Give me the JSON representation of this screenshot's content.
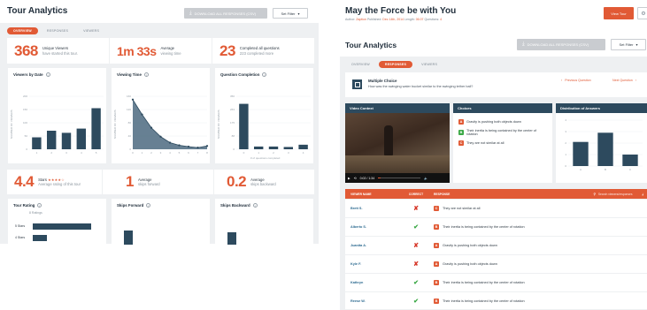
{
  "left": {
    "title": "Tour Analytics",
    "download_label": "DOWNLOAD ALL RESPONSES (CSV)",
    "filter_label": "Set Filter",
    "tabs": [
      {
        "label": "OVERVIEW",
        "active": true
      },
      {
        "label": "RESPONSES",
        "active": false
      },
      {
        "label": "VIEWERS",
        "active": false
      }
    ],
    "stats_top": [
      {
        "value": "368",
        "label": "Unique Viewers",
        "sub": "have started this tour."
      },
      {
        "value": "1m 33s",
        "label": "Average",
        "sub": "viewing time"
      },
      {
        "value": "23",
        "label": "Completed all questions",
        "sub": "223 completed more"
      }
    ],
    "charts": [
      {
        "title": "Viewers by Date",
        "ylabel": "NUMBER OF VIEWERS"
      },
      {
        "title": "Viewing Time",
        "ylabel": "NUMBER OF VIEWERS"
      },
      {
        "title": "Question Completion",
        "ylabel": "NUMBER OF VIEWERS",
        "note": "# of questions completed"
      }
    ],
    "stats_bottom": [
      {
        "value": "4.4",
        "label": "Stars",
        "stars": "★★★★☆",
        "sub": "Average rating of this tour"
      },
      {
        "value": "1",
        "label": "Average",
        "sub": "skips forward"
      },
      {
        "value": "0.2",
        "label": "Average",
        "sub": "skips backward"
      }
    ],
    "bottom_cards": [
      {
        "title": "Tour Rating",
        "sub": "8 Ratings",
        "rows": [
          "5 Stars",
          "4 Stars"
        ]
      },
      {
        "title": "Skips Forward"
      },
      {
        "title": "Skips Backward"
      }
    ]
  },
  "right": {
    "title": "May the Force be with You",
    "meta": {
      "author_label": "Author:",
      "author": "Zaption",
      "published_label": "Published:",
      "published": "Dec 14th, 2014",
      "length_label": "Length:",
      "length": "06:07",
      "questions_label": "Questions:",
      "questions": "4"
    },
    "view_tour_label": "View Tour",
    "subtitle": "Tour Analytics",
    "download_label": "DOWNLOAD ALL RESPONSES (CSV)",
    "filter_label": "Set Filter",
    "tabs": [
      {
        "label": "OVERVIEW",
        "active": false
      },
      {
        "label": "RESPONSES",
        "active": true
      },
      {
        "label": "VIEWERS",
        "active": false
      }
    ],
    "question": {
      "type": "Multiple Choice",
      "text": "How was the swinging water bucket similar to the swinging tether ball?"
    },
    "prev_label": "Previous Question",
    "next_label": "Next Question",
    "video_header": "Video Context",
    "video_time": "0:02 / 1:34",
    "choices_header": "Choices",
    "choices": [
      {
        "letter": "A",
        "text": "Gravity is pushing both objects down",
        "correct": false
      },
      {
        "letter": "B",
        "text": "Their inertia is being contained by the center of rotation",
        "correct": true
      },
      {
        "letter": "C",
        "text": "They are not similar at all",
        "correct": false
      }
    ],
    "dist_header": "Distribution of Answers",
    "table": {
      "headers": [
        "VIEWER NAME",
        "CORRECT",
        "RESPONSE"
      ],
      "search_placeholder": "Search viewers/responses",
      "rows": [
        {
          "name": "Brett S.",
          "correct": false,
          "letter": "C",
          "response": "They are not similar at all"
        },
        {
          "name": "Alberto S.",
          "correct": true,
          "letter": "B",
          "response": "Their inertia is being contained by the center of rotation"
        },
        {
          "name": "Juanita A.",
          "correct": false,
          "letter": "A",
          "response": "Gravity is pushing both objects down"
        },
        {
          "name": "Kyle F.",
          "correct": false,
          "letter": "A",
          "response": "Gravity is pushing both objects down"
        },
        {
          "name": "Kathryn",
          "correct": true,
          "letter": "B",
          "response": "Their inertia is being contained by the center of rotation"
        },
        {
          "name": "Reese W.",
          "correct": true,
          "letter": "B",
          "response": "Their inertia is being contained by the center of rotation"
        }
      ]
    }
  },
  "colors": {
    "accent": "#e15a35",
    "navy": "#2d4a5e",
    "correct": "#3aa845",
    "wrong": "#d7392b"
  },
  "chart_data": [
    {
      "type": "bar",
      "title": "Viewers by Date",
      "ylabel": "NUMBER OF VIEWERS",
      "categories": [
        "1",
        "2",
        "3",
        "4",
        "5"
      ],
      "values": [
        45,
        70,
        62,
        78,
        155
      ],
      "ylim": [
        0,
        200
      ]
    },
    {
      "type": "area",
      "title": "Viewing Time",
      "ylabel": "NUMBER OF VIEWERS",
      "x": [
        0,
        1,
        2,
        3,
        4,
        5,
        6,
        7,
        8
      ],
      "values": [
        150,
        105,
        65,
        38,
        20,
        12,
        8,
        5,
        10
      ],
      "ylim": [
        0,
        160
      ]
    },
    {
      "type": "bar",
      "title": "Question Completion",
      "ylabel": "NUMBER OF VIEWERS",
      "categories": [
        "0",
        "1",
        "2",
        "3",
        "4"
      ],
      "values": [
        300,
        18,
        18,
        15,
        30
      ],
      "ylim": [
        0,
        350
      ]
    },
    {
      "type": "bar",
      "title": "Distribution of Answers",
      "categories": [
        "A",
        "B",
        "C"
      ],
      "values": [
        2.1,
        2.9,
        1.0
      ],
      "ylim": [
        0,
        4
      ]
    }
  ]
}
